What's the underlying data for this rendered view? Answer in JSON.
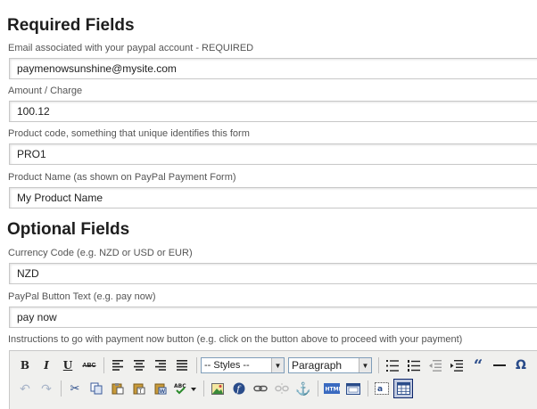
{
  "required": {
    "title": "Required Fields",
    "fields": [
      {
        "label": "Email associated with your paypal account - REQUIRED",
        "value": "paymenowsunshine@mysite.com"
      },
      {
        "label": "Amount / Charge",
        "value": "100.12"
      },
      {
        "label": "Product code, something that unique identifies this form",
        "value": "PRO1"
      },
      {
        "label": "Product Name (as shown on PayPal Payment Form)",
        "value": "My Product Name"
      }
    ]
  },
  "optional": {
    "title": "Optional Fields",
    "fields": [
      {
        "label": "Currency Code (e.g. NZD or USD or EUR)",
        "value": "NZD"
      },
      {
        "label": "PayPal Button Text (e.g. pay now)",
        "value": "pay now"
      }
    ],
    "instructions_label": "Instructions to go with payment now button (e.g. click on the button above to proceed with your payment)"
  },
  "editor": {
    "row1": {
      "bold": "B",
      "italic": "I",
      "underline": "U",
      "strike": "ABC",
      "styles_select": "-- Styles --",
      "format_select": "Paragraph"
    },
    "icons": [
      "bold-icon",
      "italic-icon",
      "underline-icon",
      "strikethrough-icon",
      "align-left-icon",
      "align-center-icon",
      "align-right-icon",
      "align-justify-icon",
      "bullet-list-icon",
      "numbered-list-icon",
      "outdent-icon",
      "indent-icon",
      "blockquote-icon",
      "horizontal-rule-icon",
      "special-char-icon",
      "undo-icon",
      "redo-icon",
      "cut-icon",
      "copy-icon",
      "paste-icon",
      "paste-text-icon",
      "paste-word-icon",
      "spellcheck-icon",
      "image-icon",
      "flash-icon",
      "link-icon",
      "unlink-icon",
      "anchor-icon",
      "html-source-icon",
      "fullscreen-icon",
      "style-props-icon",
      "table-icon"
    ],
    "colors": {
      "toolbar_bg": "#f0f0ee",
      "active_bg": "#c2cbe0"
    }
  }
}
